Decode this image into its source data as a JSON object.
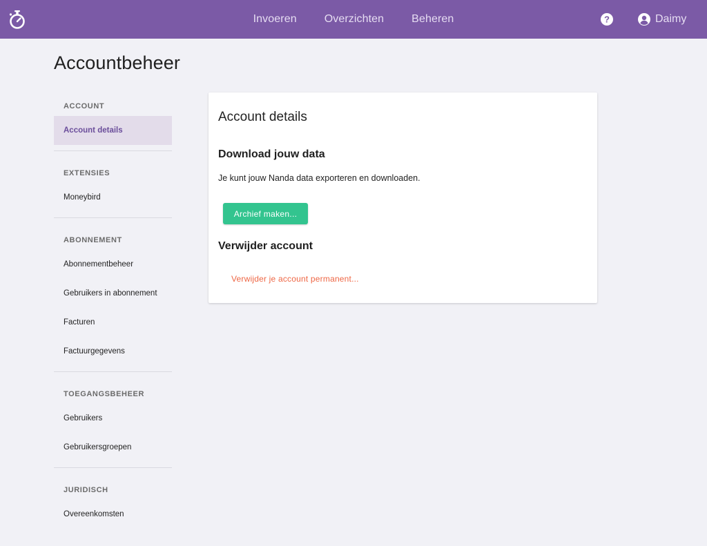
{
  "nav": {
    "links": [
      "Invoeren",
      "Overzichten",
      "Beheren"
    ],
    "user_name": "Daimy",
    "icons": {
      "logo": "stopwatch-icon",
      "help": "help-circle-icon",
      "user": "user-circle-icon"
    }
  },
  "page": {
    "title": "Accountbeheer"
  },
  "sidebar": {
    "sections": [
      {
        "header": "ACCOUNT",
        "items": [
          "Account details"
        ]
      },
      {
        "header": "EXTENSIES",
        "items": [
          "Moneybird"
        ]
      },
      {
        "header": "ABONNEMENT",
        "items": [
          "Abonnementbeheer",
          "Gebruikers in abonnement",
          "Facturen",
          "Factuurgegevens"
        ]
      },
      {
        "header": "TOEGANGSBEHEER",
        "items": [
          "Gebruikers",
          "Gebruikersgroepen"
        ]
      },
      {
        "header": "JURIDISCH",
        "items": [
          "Overeenkomsten"
        ]
      }
    ],
    "active_item": "Account details"
  },
  "card": {
    "title": "Account details",
    "download_heading": "Download jouw data",
    "download_text": "Je kunt jouw Nanda data exporteren en downloaden.",
    "archive_button": "Archief maken...",
    "delete_heading": "Verwijder account",
    "delete_link": "Verwijder je account permanent..."
  },
  "colors": {
    "navbar": "#7b5aa6",
    "background": "#f1f1f6",
    "active_bg": "#e3dcea",
    "active_text": "#6b4e9b",
    "primary_button": "#33c48f",
    "danger_link": "#ee6644"
  }
}
